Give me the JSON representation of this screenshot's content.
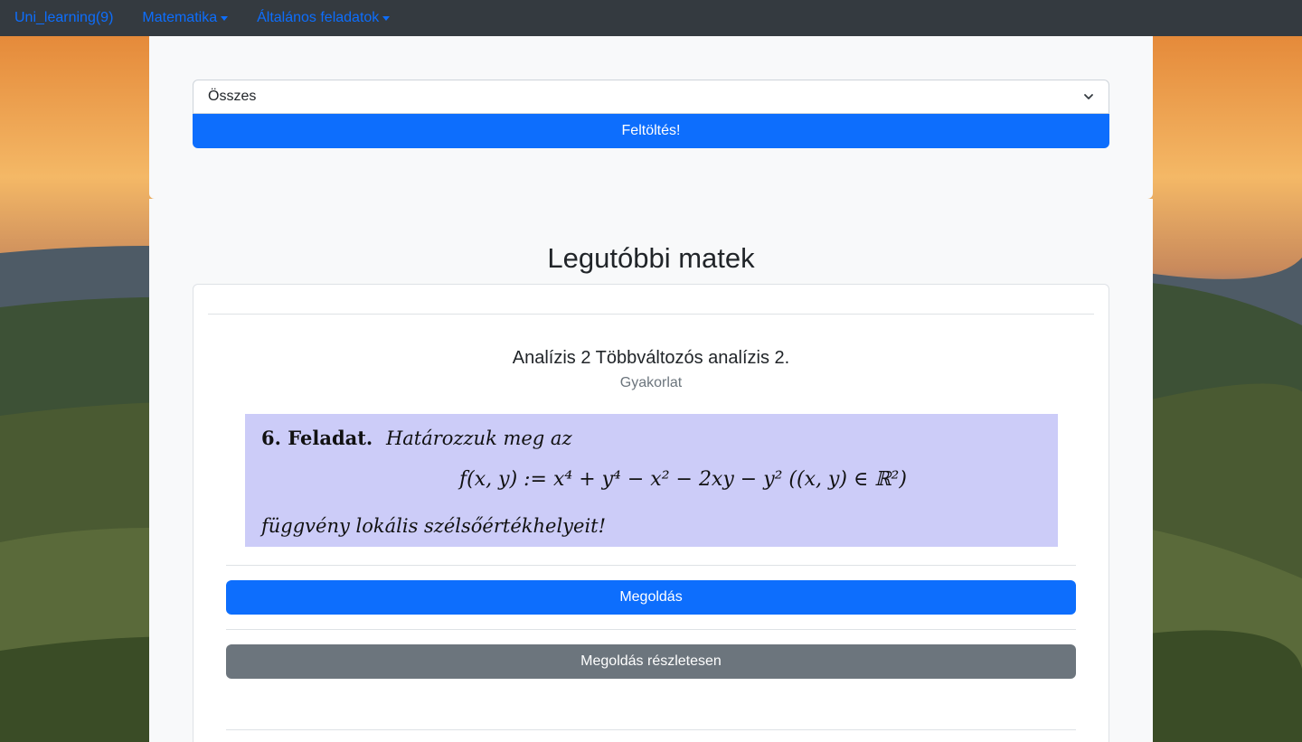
{
  "navbar": {
    "brand": "Uni_learning(9)",
    "menus": [
      {
        "label": "Matematika"
      },
      {
        "label": "Általános feladatok"
      }
    ]
  },
  "upload": {
    "select_value": "Összes",
    "button_label": "Feltöltés!"
  },
  "recent": {
    "title": "Legutóbbi matek"
  },
  "card": {
    "title": "Analízis 2 Többváltozós analízis 2.",
    "subtitle": "Gyakorlat",
    "task": {
      "number": "6. Feladat.",
      "intro": "Határozzuk meg az",
      "formula": "f(x, y) := x⁴ + y⁴ − x² − 2xy − y²   ((x, y) ∈ ℝ²)",
      "outro": "függvény lokális szélsőértékhelyeit!"
    },
    "solution_button": "Megoldás",
    "detailed_button": "Megoldás részletesen"
  },
  "colors": {
    "navbar_bg": "#343a40",
    "link": "#0d6efd",
    "primary": "#0d6efd",
    "secondary": "#6c757d",
    "task_bg": "#ccccf8"
  }
}
